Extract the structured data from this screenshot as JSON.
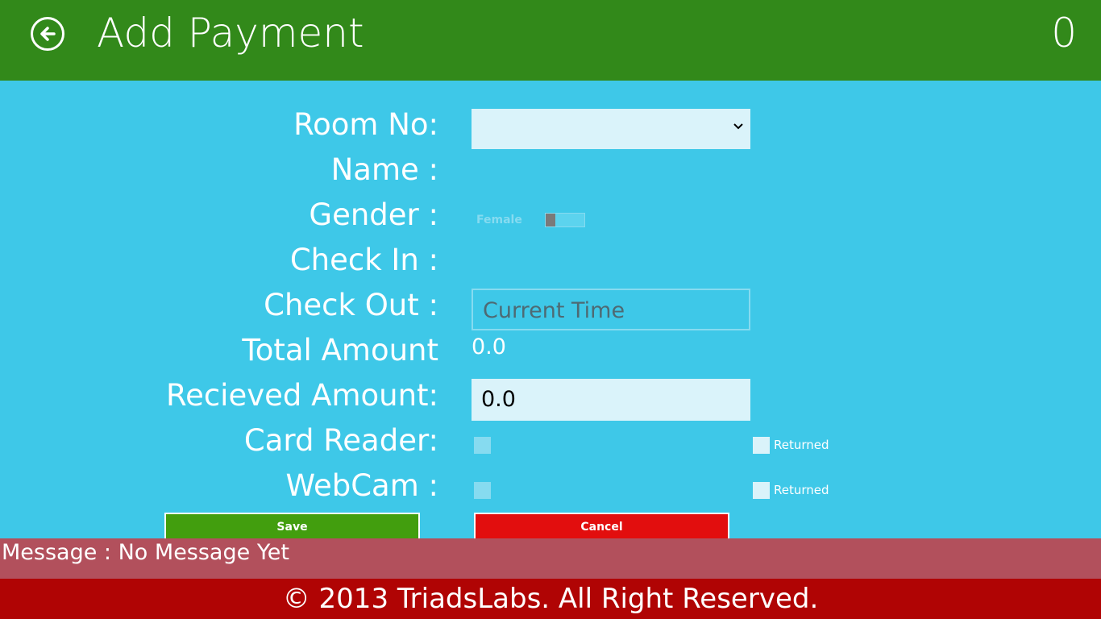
{
  "header": {
    "title": "Add Payment",
    "count": "0"
  },
  "form": {
    "room_no_label": "Room No:",
    "room_no_value": "",
    "name_label": "Name :",
    "gender_label": "Gender :",
    "gender_toggle_text": "Female",
    "check_in_label": "Check In :",
    "check_out_label": "Check Out :",
    "check_out_placeholder": "Current Time",
    "total_amount_label": "Total Amount",
    "total_amount_value": "0.0",
    "received_amount_label": "Recieved Amount:",
    "received_amount_value": "0.0",
    "card_reader_label": "Card Reader:",
    "card_reader_returned_label": "Returned",
    "webcam_label": "WebCam :",
    "webcam_returned_label": "Returned"
  },
  "buttons": {
    "save": "Save",
    "cancel": "Cancel"
  },
  "message": {
    "text": "Message :  No Message Yet"
  },
  "footer": {
    "text": "© 2013 TriadsLabs. All Right Reserved."
  },
  "icons": {
    "back": "arrow-left-circle-icon",
    "dropdown": "chevron-down-icon"
  },
  "colors": {
    "header": "#32891a",
    "background": "#3ec8e8",
    "save": "#429e0e",
    "cancel": "#e20e0e",
    "message_bar": "#b2505c",
    "footer": "#b00404"
  }
}
